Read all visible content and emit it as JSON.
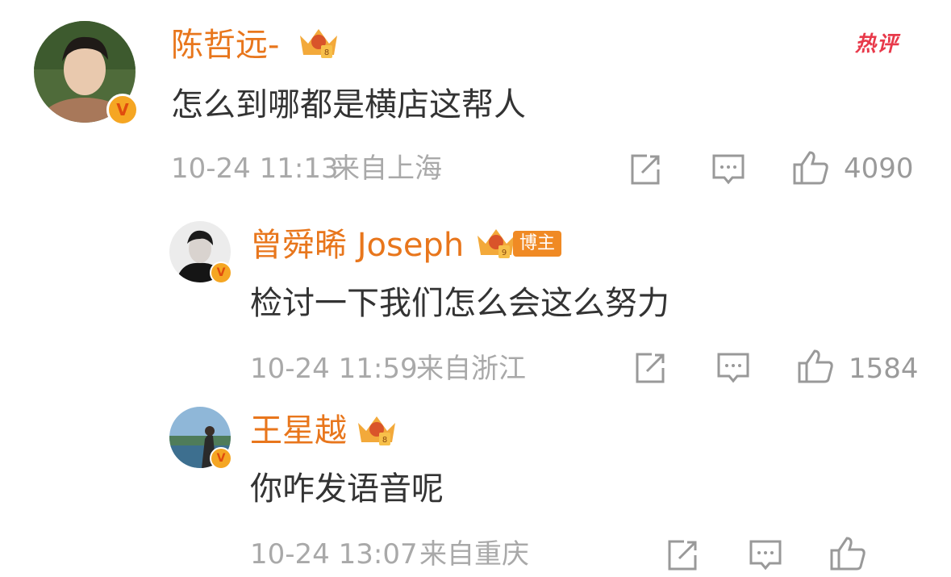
{
  "hot_label": "热评",
  "comments": [
    {
      "username": "陈哲远-",
      "content": "怎么到哪都是横店这帮人",
      "time": "10-24 11:13",
      "location": "来自上海",
      "likes": "4090"
    },
    {
      "username": "曾舜晞 Joseph",
      "badge": "博主",
      "content": "检讨一下我们怎么会这么努力",
      "time": "10-24 11:59",
      "location": "来自浙江",
      "likes": "1584"
    },
    {
      "username": "王星越",
      "content": "你咋发语音呢",
      "time": "10-24 13:07",
      "location": "来自重庆",
      "likes": ""
    }
  ],
  "colors": {
    "username": "#e8761c",
    "content": "#333333",
    "meta": "#a9a9a9",
    "hot": "#e8394a",
    "verified": "#f5a623"
  },
  "icons": [
    "crown-icon",
    "share-icon",
    "reply-icon",
    "like-icon",
    "verified-icon"
  ]
}
